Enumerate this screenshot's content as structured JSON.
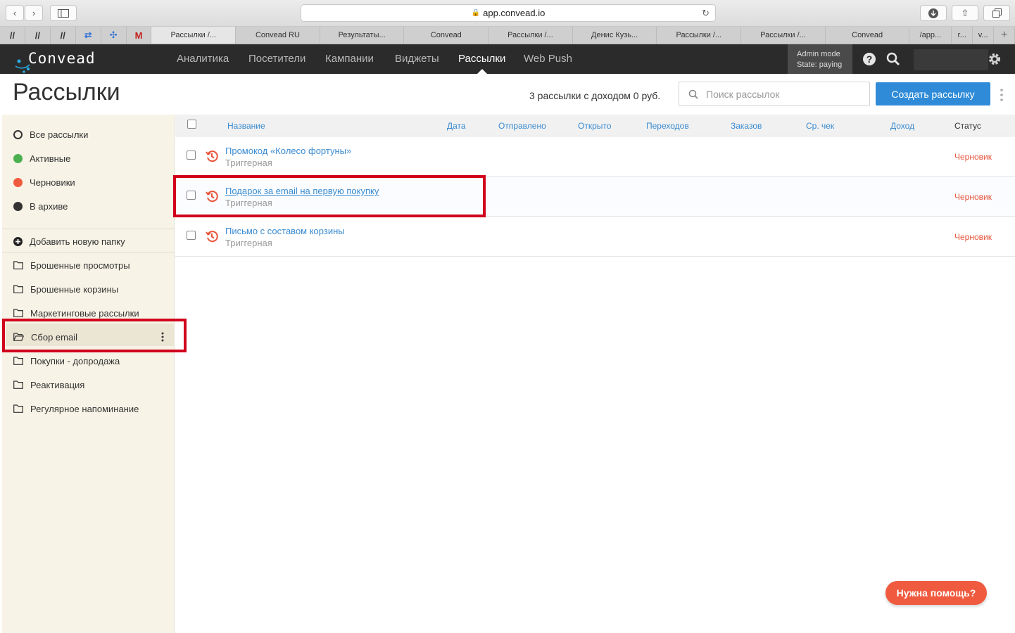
{
  "browser": {
    "url": "app.convead.io",
    "pinned_tabs": [
      "//",
      "//",
      "//",
      "⇄",
      "✣",
      "M"
    ],
    "tabs": [
      {
        "label": "Рассылки /...",
        "active": true
      },
      {
        "label": "Convead RU"
      },
      {
        "label": "Результаты..."
      },
      {
        "label": "Convead"
      },
      {
        "label": "Рассылки /..."
      },
      {
        "label": "Денис Кузь..."
      },
      {
        "label": "Рассылки /..."
      },
      {
        "label": "Рассылки /..."
      },
      {
        "label": "Convead"
      },
      {
        "label": "/app..."
      },
      {
        "label": "r..."
      },
      {
        "label": "v..."
      }
    ],
    "new_tab": "+"
  },
  "header": {
    "logo": "Convead",
    "nav": [
      "Аналитика",
      "Посетители",
      "Кампании",
      "Виджеты",
      "Рассылки",
      "Web Push"
    ],
    "active_nav": "Рассылки",
    "admin_mode": "Admin mode",
    "admin_state": "State: paying"
  },
  "page": {
    "title": "Рассылки",
    "summary": "3 рассылки с доходом 0 руб.",
    "search_placeholder": "Поиск рассылок",
    "create_button": "Создать рассылку"
  },
  "sidebar": {
    "filters": [
      {
        "label": "Все рассылки",
        "color": "outline"
      },
      {
        "label": "Активные",
        "color": "#4caf50"
      },
      {
        "label": "Черновики",
        "color": "#f05a3f"
      },
      {
        "label": "В архиве",
        "color": "#333333"
      }
    ],
    "add_folder": "Добавить новую папку",
    "folders": [
      "Брошенные просмотры",
      "Брошенные корзины",
      "Маркетинговые рассылки",
      "Сбор email",
      "Покупки - допродажа",
      "Реактивация",
      "Регулярное напоминание"
    ],
    "selected_folder": "Сбор email"
  },
  "table": {
    "columns": [
      "Название",
      "Дата",
      "Отправлено",
      "Открыто",
      "Переходов",
      "Заказов",
      "Ср. чек",
      "Доход",
      "Статус"
    ],
    "rows": [
      {
        "name": "Промокод «Колесо фортуны»",
        "type": "Триггерная",
        "status": "Черновик"
      },
      {
        "name": "Подарок за email на первую покупку",
        "type": "Триггерная",
        "status": "Черновик"
      },
      {
        "name": "Письмо с составом корзины",
        "type": "Триггерная",
        "status": "Черновик"
      }
    ]
  },
  "help_button": "Нужна помощь?",
  "colors": {
    "accent": "#2f8bd8",
    "draft": "#e8553b",
    "header": "#2b2b2b",
    "sidebar": "#f7f3e6",
    "highlight": "#d0021b"
  }
}
